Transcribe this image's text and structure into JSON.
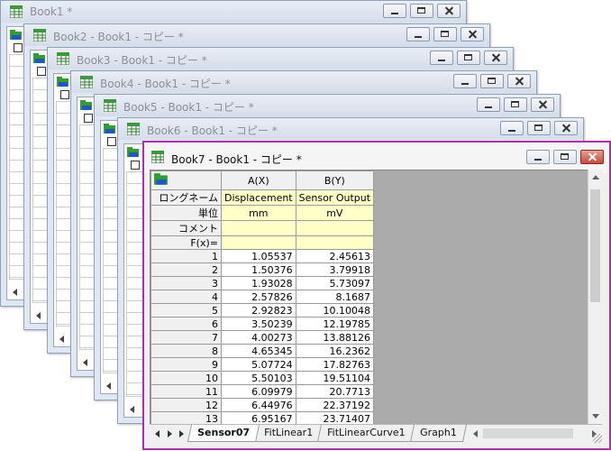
{
  "windows": [
    {
      "title": "Book1 *"
    },
    {
      "title": "Book2 - Book1 - コピー *"
    },
    {
      "title": "Book3 - Book1 - コピー *"
    },
    {
      "title": "Book4 - Book1 - コピー *"
    },
    {
      "title": "Book5 - Book1 - コピー *"
    },
    {
      "title": "Book6 - Book1 - コピー *"
    }
  ],
  "active_window": {
    "title": "Book7 - Book1 - コピー *",
    "columns": [
      {
        "header": "A(X)",
        "long_name": "Displacement",
        "unit": "mm",
        "comment": "",
        "fx": ""
      },
      {
        "header": "B(Y)",
        "long_name": "Sensor Output",
        "unit": "mV",
        "comment": "",
        "fx": ""
      }
    ],
    "row_labels": {
      "long_name": "ロングネーム",
      "unit": "単位",
      "comment": "コメント",
      "fx": "F(x)="
    },
    "rows": [
      {
        "n": "1",
        "a": "1.05537",
        "b": "2.45613"
      },
      {
        "n": "2",
        "a": "1.50376",
        "b": "3.79918"
      },
      {
        "n": "3",
        "a": "1.93028",
        "b": "5.73097"
      },
      {
        "n": "4",
        "a": "2.57826",
        "b": "8.1687"
      },
      {
        "n": "5",
        "a": "2.92823",
        "b": "10.10048"
      },
      {
        "n": "6",
        "a": "3.50239",
        "b": "12.19785"
      },
      {
        "n": "7",
        "a": "4.00273",
        "b": "13.88126"
      },
      {
        "n": "8",
        "a": "4.65345",
        "b": "16.2362"
      },
      {
        "n": "9",
        "a": "5.07724",
        "b": "17.82763"
      },
      {
        "n": "10",
        "a": "5.50103",
        "b": "19.51104"
      },
      {
        "n": "11",
        "a": "6.09979",
        "b": "20.7713"
      },
      {
        "n": "12",
        "a": "6.44976",
        "b": "22.37192"
      },
      {
        "n": "13",
        "a": "6.95167",
        "b": "23.71407"
      }
    ],
    "tabs": [
      "Sensor07",
      "FitLinear1",
      "FitLinearCurve1",
      "Graph1"
    ],
    "active_tab": 0
  },
  "colors": {
    "active_border": "#b02ea8",
    "meta_row_bg": "#ffffc8",
    "sheet_bg": "#ababab"
  }
}
